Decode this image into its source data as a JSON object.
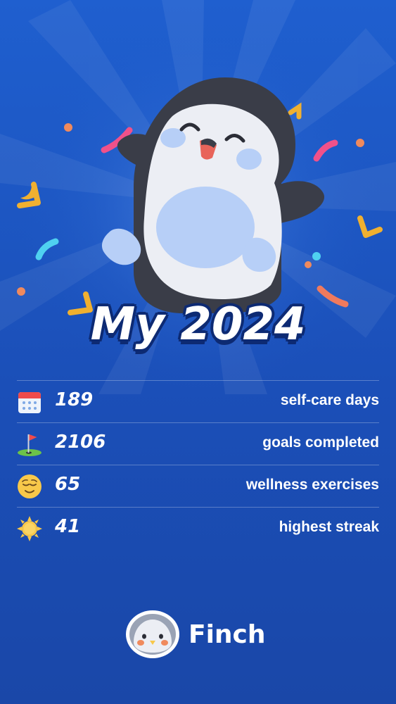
{
  "title": "My 2024",
  "stats": [
    {
      "icon": "calendar-icon",
      "value": "189",
      "label": "self-care days"
    },
    {
      "icon": "golf-flag-icon",
      "value": "2106",
      "label": "goals completed"
    },
    {
      "icon": "relieved-face-icon",
      "value": "65",
      "label": "wellness exercises"
    },
    {
      "icon": "sun-icon",
      "value": "41",
      "label": "highest streak"
    }
  ],
  "brand": {
    "name": "Finch"
  },
  "colors": {
    "background": "#1f5fcf",
    "title_outline": "#0d2a73",
    "penguin_dark": "#3a3d48",
    "penguin_belly": "#b7cff7"
  }
}
